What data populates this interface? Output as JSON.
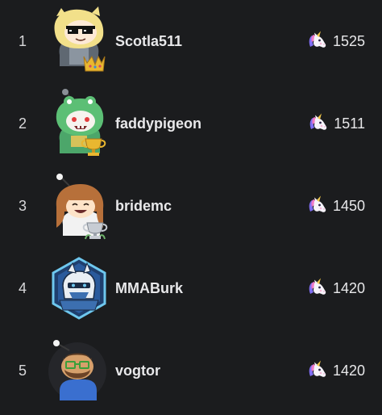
{
  "leaderboard": [
    {
      "rank": "1",
      "username": "Scotla511",
      "score": "1525",
      "badge": "crown-icon"
    },
    {
      "rank": "2",
      "username": "faddypigeon",
      "score": "1511",
      "badge": "gold-trophy-icon"
    },
    {
      "rank": "3",
      "username": "bridemc",
      "score": "1450",
      "badge": "silver-trophy-icon"
    },
    {
      "rank": "4",
      "username": "MMABurk",
      "score": "1420",
      "badge": ""
    },
    {
      "rank": "5",
      "username": "vogtor",
      "score": "1420",
      "badge": ""
    }
  ],
  "score_icon": "unicorn-icon",
  "colors": {
    "background": "#1b1c1e",
    "text": "#e8e8ea",
    "gold": "#e9b730",
    "silver": "#c7ccd3",
    "hex_frame": "#6ec7ee"
  }
}
